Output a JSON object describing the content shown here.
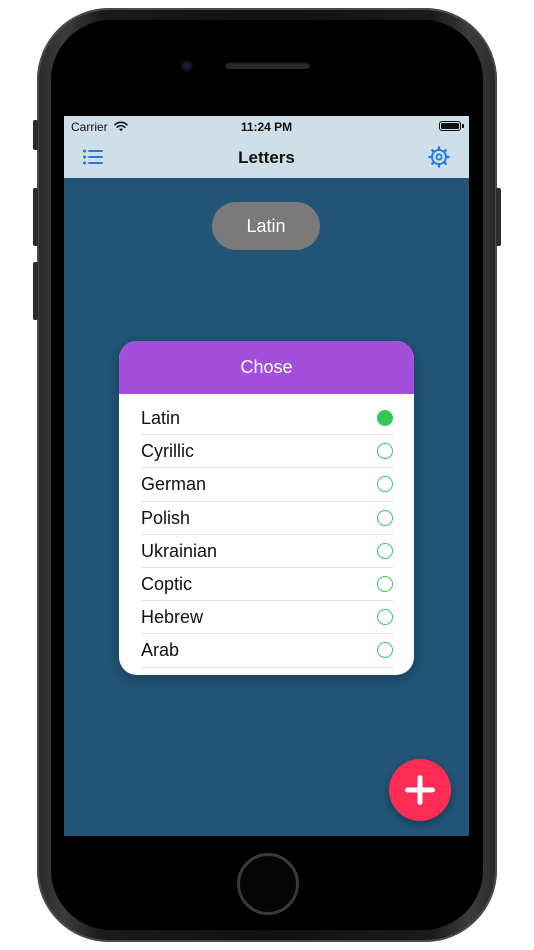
{
  "status_bar": {
    "carrier": "Carrier",
    "time": "11:24 PM",
    "wifi_icon": "wifi-icon",
    "battery_icon": "battery-full-icon",
    "battery_level": 1.0
  },
  "nav": {
    "title": "Letters",
    "left_icon": "list-icon",
    "right_icon": "gear-icon",
    "background": "#cfdfe8",
    "accent": "#1e7ae8"
  },
  "main": {
    "background": "#215476",
    "current_language": "Latin"
  },
  "dialog": {
    "title": "Chose",
    "header_color": "#a44fdc",
    "radio_color": "#34c759",
    "options": [
      {
        "label": "Latin",
        "selected": true
      },
      {
        "label": "Cyrillic",
        "selected": false
      },
      {
        "label": "German",
        "selected": false
      },
      {
        "label": "Polish",
        "selected": false
      },
      {
        "label": "Ukrainian",
        "selected": false
      },
      {
        "label": "Coptic",
        "selected": false
      },
      {
        "label": "Hebrew",
        "selected": false
      },
      {
        "label": "Arab",
        "selected": false
      }
    ]
  },
  "fab": {
    "icon": "plus-icon",
    "color": "#ff2d55"
  }
}
